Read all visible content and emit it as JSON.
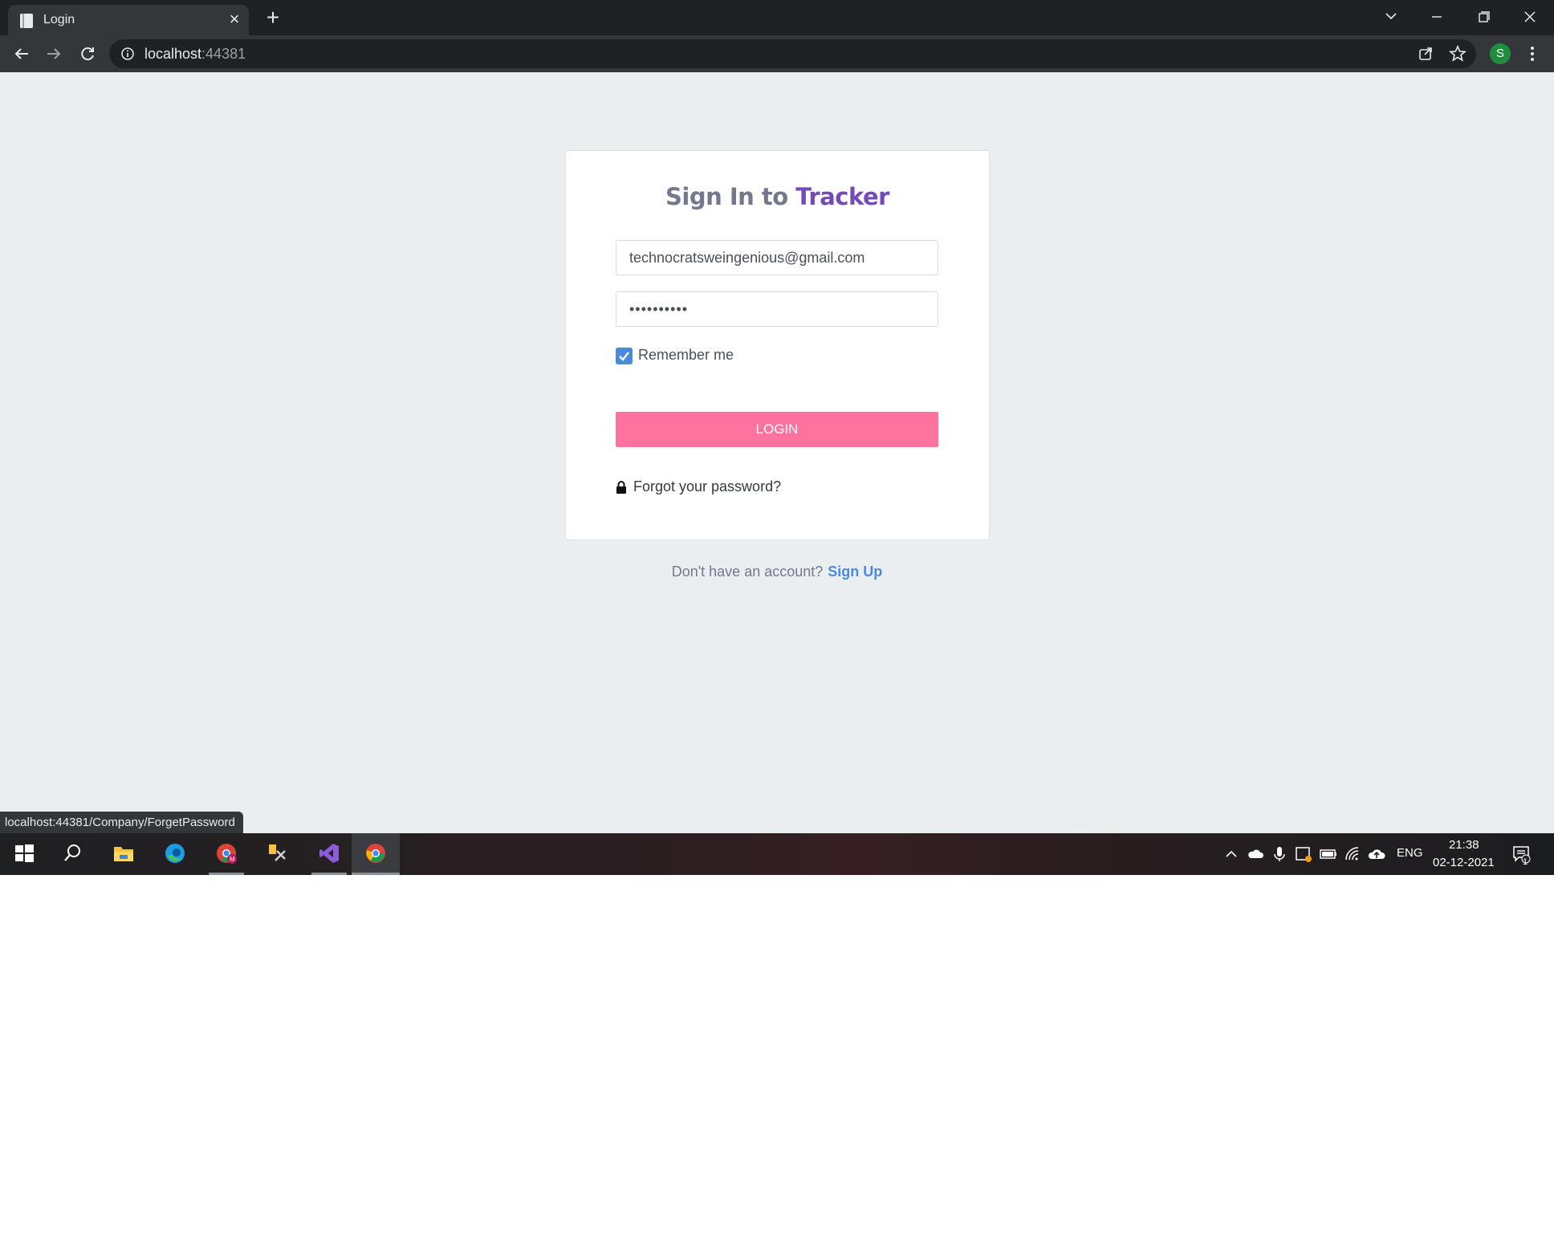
{
  "browser": {
    "tab_title": "Login",
    "url_host": "localhost",
    "url_port": ":44381",
    "profile_initial": "S",
    "status_url": "localhost:44381/Company/ForgetPassword"
  },
  "login": {
    "title_prefix": "Sign In to ",
    "title_brand": "Tracker",
    "email_value": "technocratsweingenious@gmail.com",
    "password_value": "••••••••••",
    "remember_label": "Remember me",
    "remember_checked": true,
    "login_label": "LOGIN",
    "forgot_label": "Forgot your password?",
    "signup_prompt": "Don't have an account?",
    "signup_link": "Sign Up"
  },
  "taskbar": {
    "apps": [
      "windows-start-icon",
      "search-icon",
      "file-explorer-icon",
      "edge-icon",
      "chrome-profile-icon",
      "tools-icon",
      "visual-studio-icon",
      "chrome-icon"
    ],
    "language": "ENG",
    "time": "21:38",
    "date": "02-12-2021",
    "notification_count": "1"
  },
  "colors": {
    "brand": "#7449b8",
    "login_button": "#fd729e",
    "link": "#4a8bdc",
    "page_bg": "#ebeef1"
  }
}
